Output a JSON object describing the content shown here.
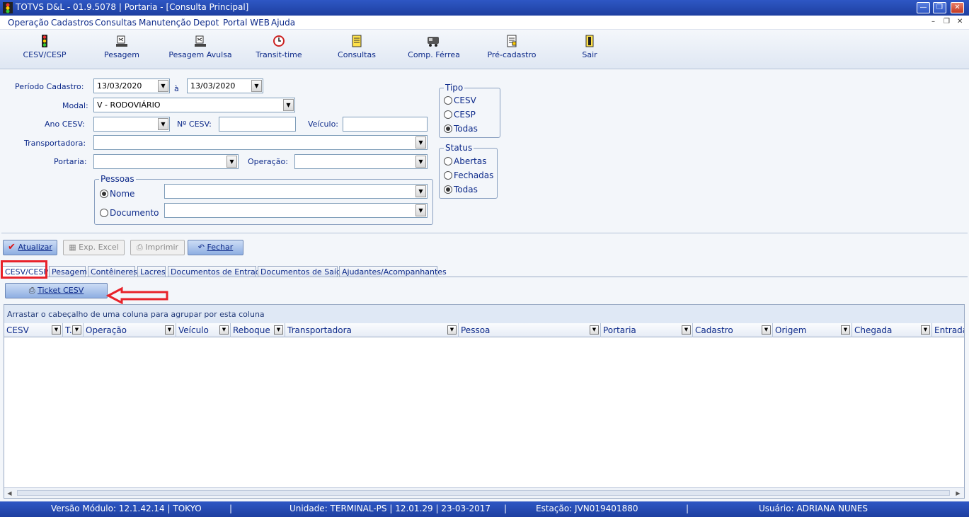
{
  "window": {
    "title": "TOTVS D&L - 01.9.5078 | Portaria - [Consulta Principal]",
    "minimize_glyph": "—",
    "restore_glyph": "❐",
    "close_glyph": "✕",
    "mdi_minimize": "–",
    "mdi_restore": "❐",
    "mdi_close": "✕"
  },
  "menu": {
    "items": [
      "Operação",
      "Cadastros",
      "Consultas",
      "Manutenção",
      "Depot",
      "Portal WEB",
      "Ajuda"
    ]
  },
  "toolbar": {
    "buttons": [
      {
        "label": "CESV/CESP",
        "icon": "traffic-light-icon"
      },
      {
        "label": "Pesagem",
        "icon": "scale-icon"
      },
      {
        "label": "Pesagem Avulsa",
        "icon": "scale-icon"
      },
      {
        "label": "Transit-time",
        "icon": "clock-icon"
      },
      {
        "label": "Consultas",
        "icon": "document-search-icon"
      },
      {
        "label": "Comp. Férrea",
        "icon": "train-icon"
      },
      {
        "label": "Pré-cadastro",
        "icon": "form-icon"
      },
      {
        "label": "Sair",
        "icon": "exit-door-icon"
      }
    ]
  },
  "filters": {
    "periodo_label": "Período Cadastro:",
    "periodo_inicio": "13/03/2020",
    "periodo_sep": "à",
    "periodo_fim": "13/03/2020",
    "modal_label": "Modal:",
    "modal_value": "V - RODOVIÁRIO",
    "ano_cesv_label": "Ano CESV:",
    "ano_cesv_value": "",
    "num_cesv_label": "Nº CESV:",
    "num_cesv_value": "",
    "veiculo_label": "Veículo:",
    "veiculo_value": "",
    "transportadora_label": "Transportadora:",
    "transportadora_value": "",
    "portaria_label": "Portaria:",
    "portaria_value": "",
    "operacao_label": "Operação:",
    "operacao_value": "",
    "pessoas": {
      "title": "Pessoas",
      "nome_label": "Nome",
      "nome_selected": true,
      "documento_label": "Documento",
      "documento_selected": false,
      "nome_value": "",
      "documento_value": ""
    },
    "tipo": {
      "title": "Tipo",
      "options": [
        "CESV",
        "CESP",
        "Todas"
      ],
      "selected": "Todas"
    },
    "status": {
      "title": "Status",
      "options": [
        "Abertas",
        "Fechadas",
        "Todas"
      ],
      "selected": "Todas"
    }
  },
  "actions": {
    "atualizar": "Atualizar",
    "exp_excel": "Exp. Excel",
    "imprimir": "Imprimir",
    "fechar": "Fechar"
  },
  "tabs": [
    {
      "label": "CESV/CESP",
      "active": true
    },
    {
      "label": "Pesagem",
      "active": false
    },
    {
      "label": "Contêineres",
      "active": false
    },
    {
      "label": "Lacres",
      "active": false
    },
    {
      "label": "Documentos de Entrada",
      "active": false
    },
    {
      "label": "Documentos de Saída",
      "active": false
    },
    {
      "label": "Ajudantes/Acompanhantes",
      "active": false
    }
  ],
  "ticket_button": "Ticket CESV",
  "annotation_color": "#e8222a",
  "grid": {
    "group_hint": "Arrastar o cabeçalho de uma coluna para agrupar por esta coluna",
    "columns": [
      "CESV",
      "T.",
      "Operação",
      "Veículo",
      "Reboque",
      "Transportadora",
      "Pessoa",
      "Portaria",
      "Cadastro",
      "Origem",
      "Chegada",
      "Entrada"
    ],
    "rows": []
  },
  "statusbar": {
    "versao": "Versão Módulo:  12.1.42.14  |  TOKYO",
    "sep1": "|",
    "unidade": "Unidade: TERMINAL-PS | 12.01.29 | 23-03-2017",
    "sep2": "|",
    "estacao": "Estação: JVN019401880",
    "sep3": "|",
    "usuario": "Usuário: ADRIANA NUNES"
  }
}
